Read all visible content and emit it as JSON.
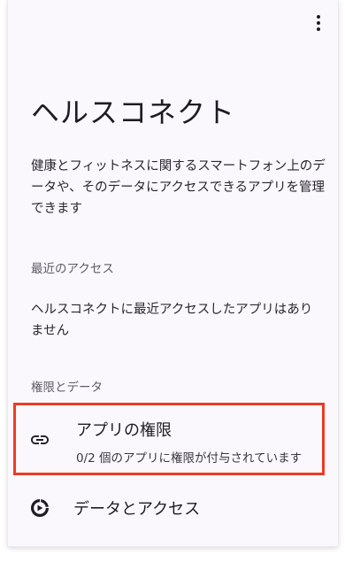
{
  "header": {
    "overflow_menu_icon": "more-vert-icon"
  },
  "page": {
    "title": "ヘルスコネクト",
    "description": "健康とフィットネスに関するスマートフォン上のデータや、そのデータにアクセスできるアプリを管理できます"
  },
  "recent_access": {
    "header": "最近のアクセス",
    "empty_message": "ヘルスコネクトに最近アクセスしたアプリはありません"
  },
  "permissions_and_data": {
    "header": "権限とデータ",
    "items": [
      {
        "icon": "link-icon",
        "title": "アプリの権限",
        "subtitle": "0/2 個のアプリに権限が付与されています"
      },
      {
        "icon": "data-access-icon",
        "title": "データとアクセス"
      }
    ]
  },
  "colors": {
    "highlight_border": "#ef3a24",
    "background": "#fbf8fd",
    "text_primary": "#1f1b24",
    "text_secondary": "#5f5a66"
  }
}
